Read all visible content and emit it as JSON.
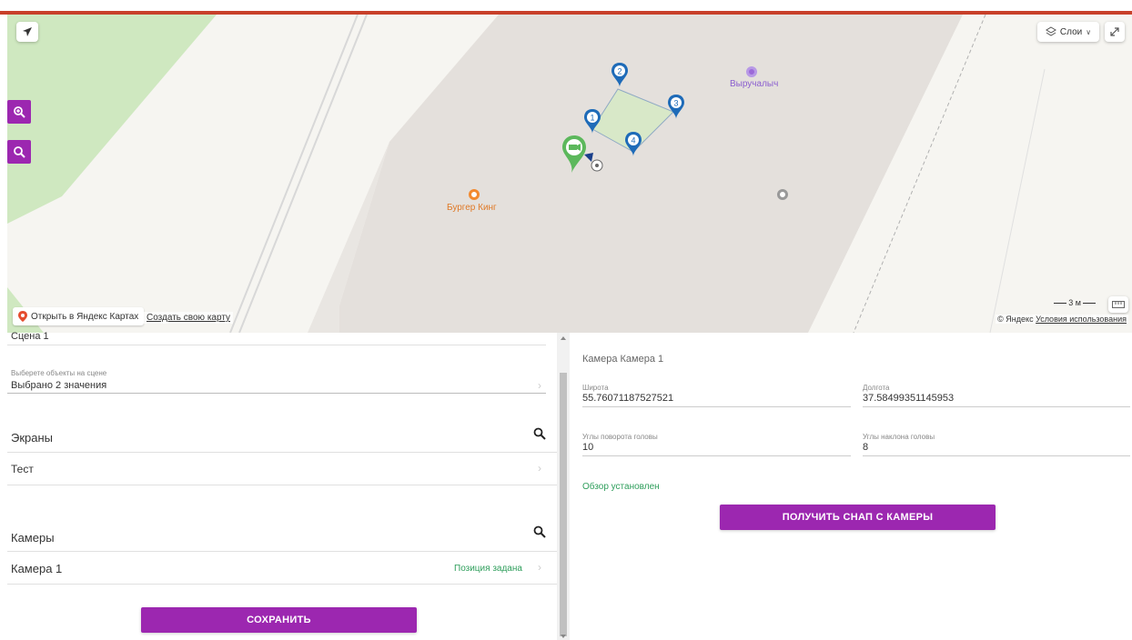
{
  "map": {
    "poi_burger": "Бургер Кинг",
    "poi_vyruchalych": "Выручалыч",
    "layers_label": "Слои",
    "open_yandex": "Открыть в Яндекс Картах",
    "create_map": "Создать свою карту",
    "copyright": "© Яндекс",
    "terms": "Условия использования",
    "scale_label": "3 м",
    "markers": [
      "1",
      "2",
      "3",
      "4"
    ],
    "colors": {
      "accent": "#9c27b0",
      "marker_blue": "#1e6bb8",
      "marker_green": "#5cb85c",
      "polygon_fill": "#d8e8c8"
    }
  },
  "left": {
    "scene_value": "Сцена 1",
    "objects_label": "Выберете объекты на сцене",
    "objects_value": "Выбрано 2 значения",
    "screens_title": "Экраны",
    "screen_item": "Тест",
    "cameras_title": "Камеры",
    "camera_item": "Камера 1",
    "camera_status": "Позиция задана",
    "save_label": "СОХРАНИТЬ"
  },
  "right": {
    "camera_title": "Камера Камера 1",
    "lat_label": "Широта",
    "lat_value": "55.76071187527521",
    "lon_label": "Долгота",
    "lon_value": "37.58499351145953",
    "rotate_label": "Углы поворота головы",
    "rotate_value": "10",
    "tilt_label": "Углы наклона головы",
    "tilt_value": "8",
    "overview_status": "Обзор установлен",
    "snap_label": "ПОЛУЧИТЬ СНАП С КАМЕРЫ"
  }
}
